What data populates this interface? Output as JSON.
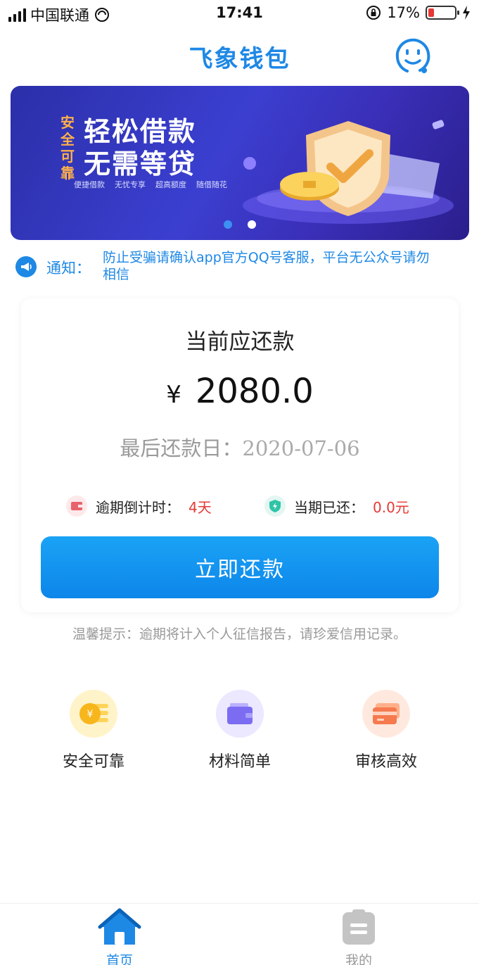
{
  "status_bar": {
    "carrier": "中国联通",
    "time": "17:41",
    "battery": "17%",
    "battery_level": 0.17
  },
  "header": {
    "title": "飞象钱包",
    "service_icon": "customer-service-icon"
  },
  "banner": {
    "tag": "安全可靠",
    "headline_1": "轻松借款",
    "headline_2": "无需等贷",
    "features": [
      "便捷借款",
      "无忧专享",
      "超高额度",
      "随借随花"
    ],
    "active_slide": 1,
    "slide_count": 2
  },
  "notice": {
    "label": "通知：",
    "text": "防止受骗请确认app官方QQ号客服，平台无公众号请勿相信"
  },
  "repayment": {
    "title": "当前应还款",
    "currency": "¥",
    "amount": "2080.0",
    "due_label": "最后还款日：",
    "due_date": "2020-07-06",
    "overdue_label": "逾期倒计时：",
    "overdue_value": "4天",
    "paid_label": "当期已还：",
    "paid_value": "0.0元",
    "button_label": "立即还款"
  },
  "tip": "温馨提示：逾期将计入个人征信报告，请珍爱信用记录。",
  "features": [
    {
      "label": "安全可靠",
      "icon": "coin-icon",
      "color": "#fff3c9"
    },
    {
      "label": "材料简单",
      "icon": "wallet-icon",
      "color": "#ebe8ff"
    },
    {
      "label": "审核高效",
      "icon": "card-icon",
      "color": "#ffe9df"
    }
  ],
  "tabs": [
    {
      "label": "首页",
      "icon": "home-icon",
      "active": true
    },
    {
      "label": "我的",
      "icon": "clipboard-icon",
      "active": false
    }
  ],
  "colors": {
    "primary": "#1e88e5",
    "danger": "#e53935",
    "banner": "#3b3fd0"
  }
}
